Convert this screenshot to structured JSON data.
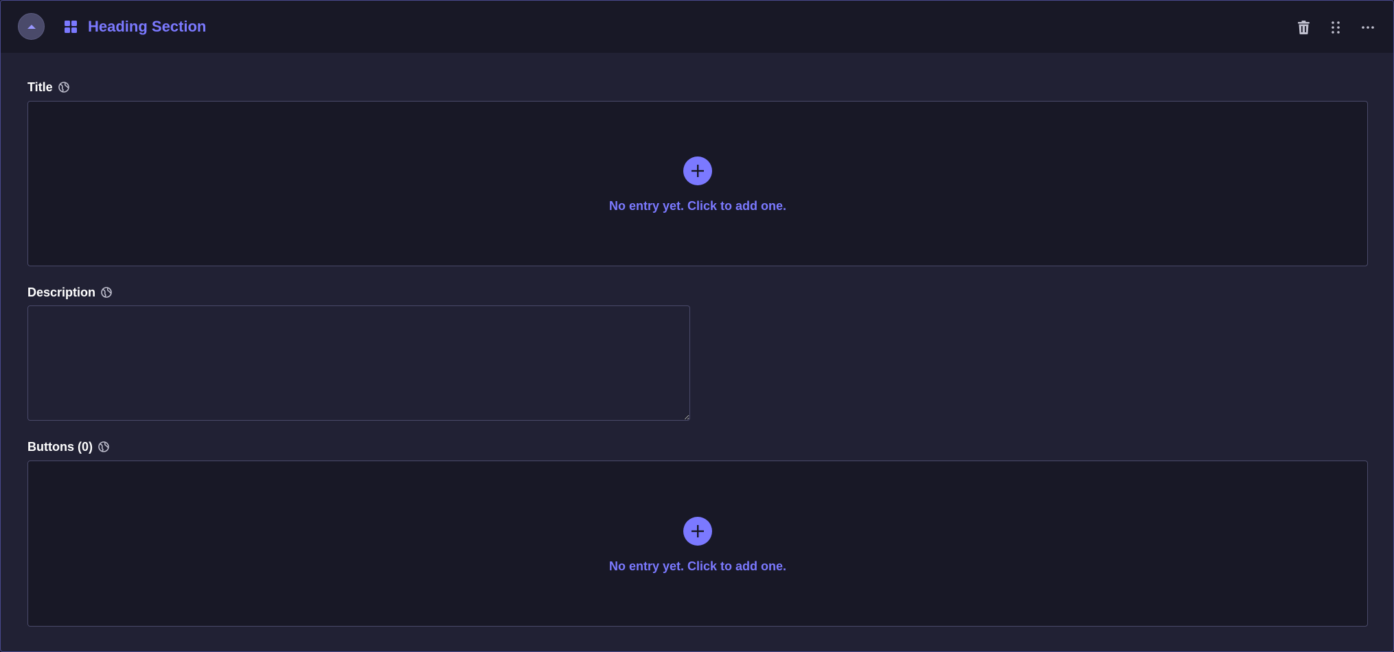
{
  "header": {
    "title": "Heading Section",
    "toggle_icon": "chevron-up-icon",
    "block_icon": "grid-icon",
    "actions": [
      "trash-icon",
      "drag-handle-icon",
      "more-icon"
    ]
  },
  "fields": {
    "title": {
      "label": "Title",
      "empty_text": "No entry yet. Click to add one."
    },
    "description": {
      "label": "Description",
      "value": ""
    },
    "buttons": {
      "label": "Buttons (0)",
      "empty_text": "No entry yet. Click to add one."
    }
  },
  "colors": {
    "accent": "#7b79ff",
    "background": "#212134",
    "surface": "#181826",
    "border": "#4a4a6a"
  }
}
